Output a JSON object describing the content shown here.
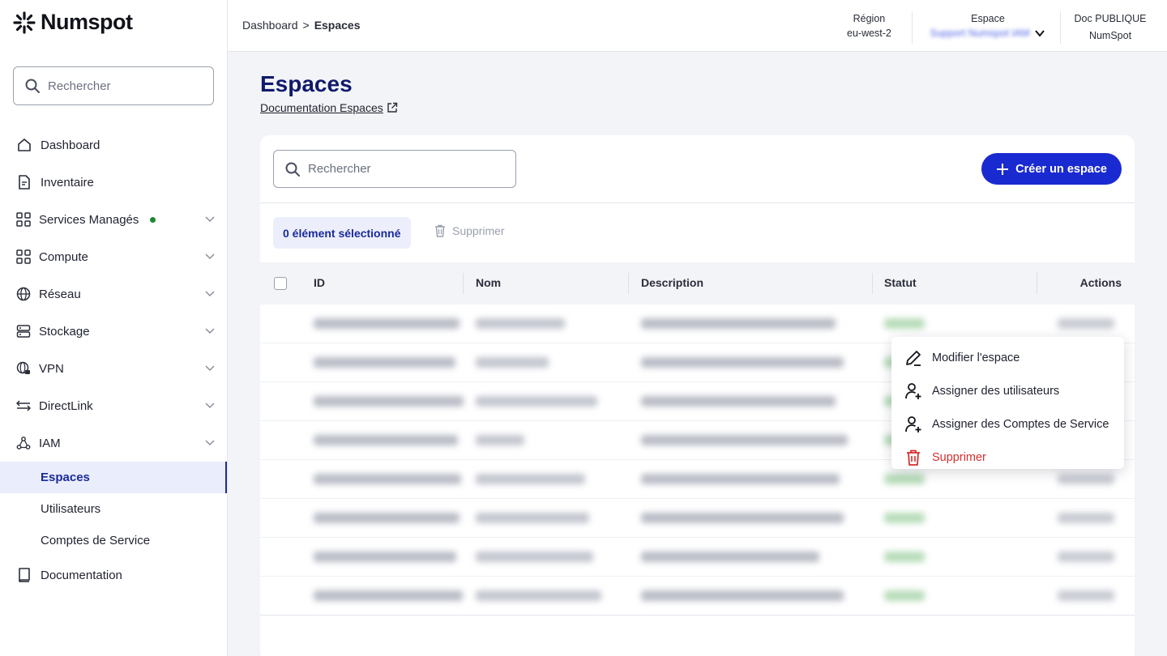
{
  "brand": {
    "name": "Numspot"
  },
  "sidebar": {
    "search_placeholder": "Rechercher",
    "items": [
      {
        "label": "Dashboard",
        "icon": "home-icon"
      },
      {
        "label": "Inventaire",
        "icon": "document-icon"
      },
      {
        "label": "Services Managés",
        "icon": "grid-icon",
        "status_dot": "#1c8a2e"
      },
      {
        "label": "Compute",
        "icon": "grid-icon"
      },
      {
        "label": "Réseau",
        "icon": "globe-icon"
      },
      {
        "label": "Stockage",
        "icon": "storage-icon"
      },
      {
        "label": "VPN",
        "icon": "globe-lock-icon"
      },
      {
        "label": "DirectLink",
        "icon": "arrows-icon"
      },
      {
        "label": "IAM",
        "icon": "people-network-icon"
      }
    ],
    "iam_sub": [
      "Espaces",
      "Utilisateurs",
      "Comptes de Service"
    ],
    "active_sub": "Espaces",
    "documentation": "Documentation"
  },
  "topbar": {
    "breadcrumb": [
      "Dashboard",
      "Espaces"
    ],
    "breadcrumb_sep": ">",
    "region_label": "Région",
    "region_value": "eu-west-2",
    "espace_label": "Espace",
    "espace_value": "Support Numspot IAM",
    "doc_label": "Doc PUBLIQUE",
    "doc_value": "NumSpot"
  },
  "page": {
    "title": "Espaces",
    "doc_link": "Documentation Espaces"
  },
  "table": {
    "search_placeholder": "Rechercher",
    "create_button": "Créer un espace",
    "selection": "0 élément sélectionné",
    "delete_button": "Supprimer",
    "columns": [
      "ID",
      "Nom",
      "Description",
      "Statut",
      "Actions"
    ],
    "row_count": 8
  },
  "context_menu": {
    "items": [
      {
        "label": "Modifier l'espace",
        "icon": "pencil-icon"
      },
      {
        "label": "Assigner des utilisateurs",
        "icon": "user-plus-icon"
      },
      {
        "label": "Assigner des Comptes de Service",
        "icon": "user-plus-icon"
      },
      {
        "label": "Supprimer",
        "icon": "trash-icon",
        "danger": true
      }
    ]
  },
  "colors": {
    "accent": "#1a2ad1",
    "title": "#0f1a6b",
    "danger": "#d62f2f"
  }
}
